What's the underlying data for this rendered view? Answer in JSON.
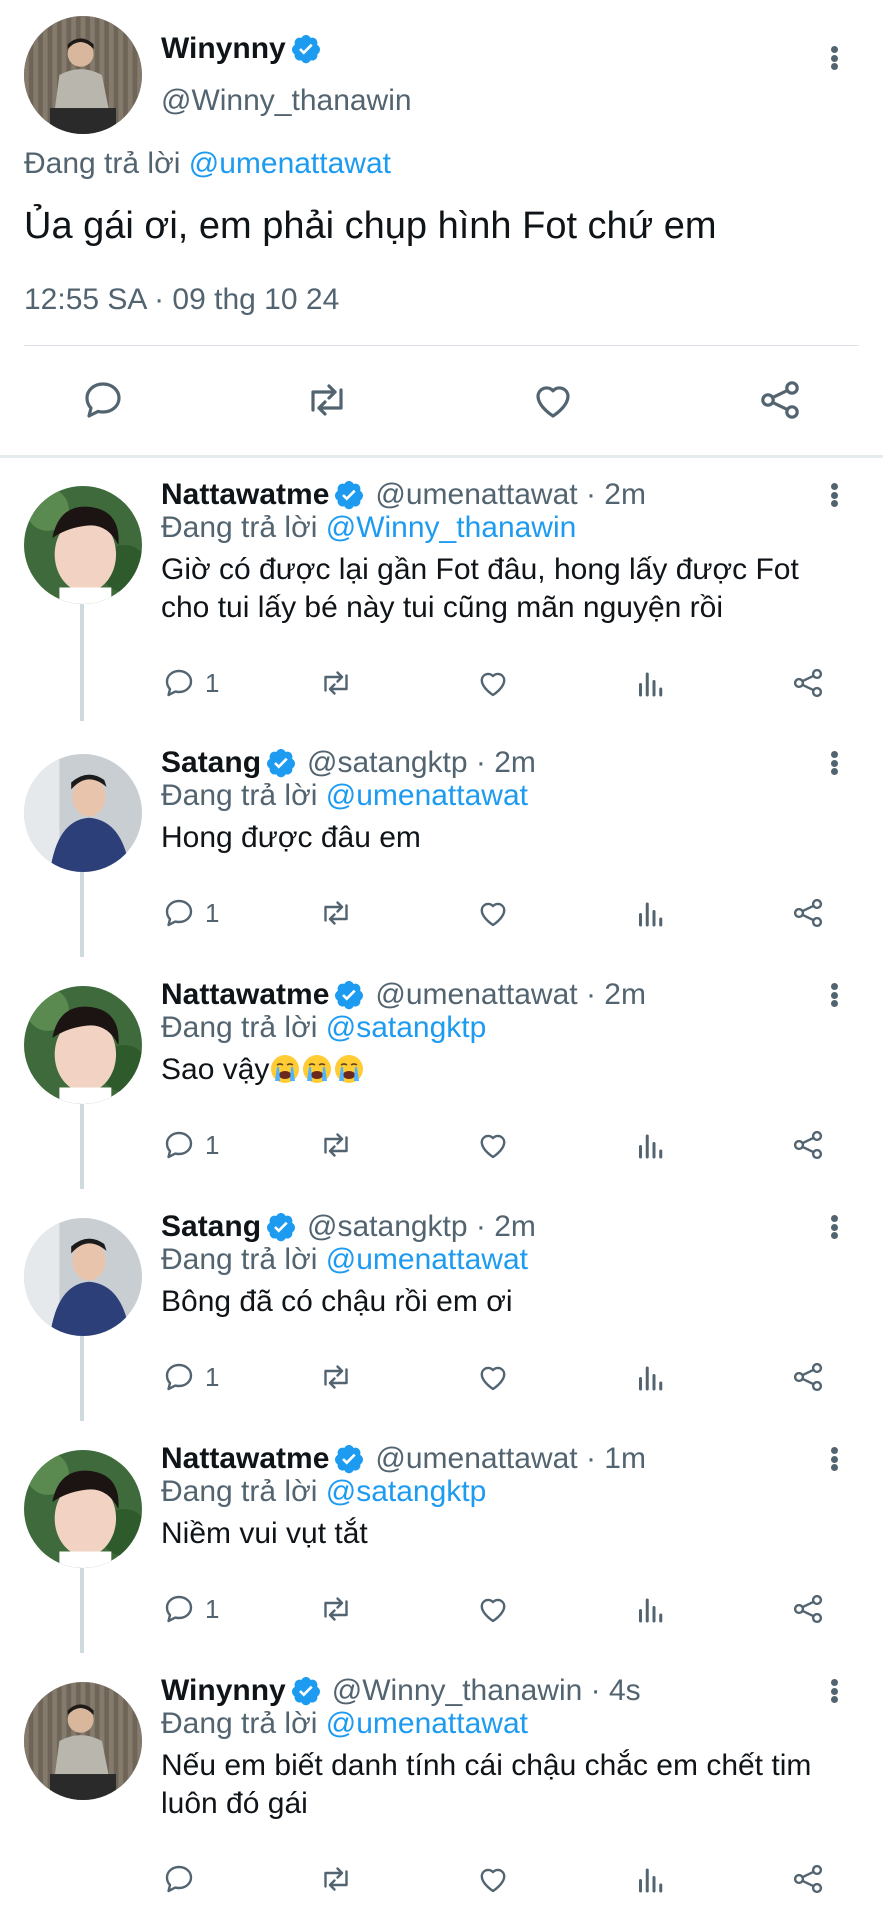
{
  "main_tweet": {
    "author_name": "Winynny",
    "author_handle": "@Winny_thanawin",
    "replying_prefix": "Đang trả lời",
    "replying_to": "@umenattawat",
    "text": "Ủa gái ơi, em phải chụp hình Fot chứ em",
    "timestamp": "12:55 SA · 09 thg 10 24",
    "actions": [
      "reply-icon",
      "retweet-icon",
      "like-icon",
      "share-icon"
    ]
  },
  "replies": [
    {
      "name": "Nattawatme",
      "handle": "@umenattawat · 2m",
      "replying_prefix": "Đang trả lời",
      "replying_to": "@Winny_thanawin",
      "text": "Giờ có được lại gần Fot đâu, hong lấy được Fot cho tui lấy bé này tui cũng mãn nguyện rồi",
      "reply_count": "1"
    },
    {
      "name": "Satang",
      "handle": "@satangktp · 2m",
      "replying_prefix": "Đang trả lời",
      "replying_to": "@umenattawat",
      "text": "Hong được đâu em",
      "reply_count": "1"
    },
    {
      "name": "Nattawatme",
      "handle": "@umenattawat · 2m",
      "replying_prefix": "Đang trả lời",
      "replying_to": "@satangktp",
      "text": "Sao vậy",
      "emoji_count": 3,
      "reply_count": "1"
    },
    {
      "name": "Satang",
      "handle": "@satangktp · 2m",
      "replying_prefix": "Đang trả lời",
      "replying_to": "@umenattawat",
      "text": "Bông đã có chậu rồi em ơi",
      "reply_count": "1"
    },
    {
      "name": "Nattawatme",
      "handle": "@umenattawat · 1m",
      "replying_prefix": "Đang trả lời",
      "replying_to": "@satangktp",
      "text": "Niềm vui vụt tắt",
      "reply_count": "1"
    },
    {
      "name": "Winynny",
      "handle": "@Winny_thanawin · 4s",
      "replying_prefix": "Đang trả lời",
      "replying_to": "@umenattawat",
      "text": "Nếu em biết danh tính cái chậu chắc em chết tim luôn đó gái",
      "reply_count": ""
    }
  ],
  "colors": {
    "accent": "#1d9bf0",
    "text_primary": "#0f1419",
    "text_secondary": "#536471",
    "divider": "#dde3e8"
  }
}
